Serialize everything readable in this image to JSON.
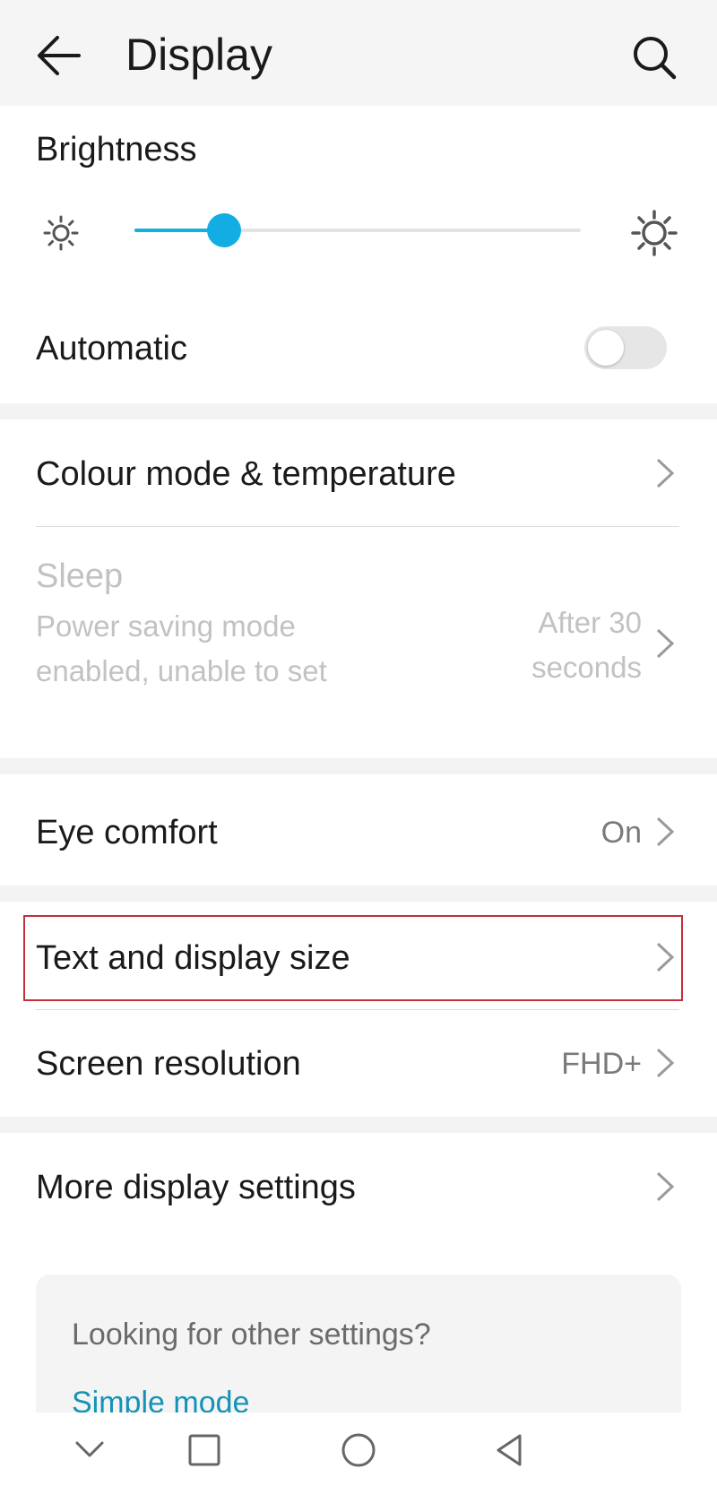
{
  "header": {
    "title": "Display",
    "back_icon": "arrow-left-icon",
    "search_icon": "search-icon"
  },
  "brightness": {
    "label": "Brightness",
    "level_fraction": 0.2,
    "accent_color": "#17aee0",
    "low_icon": "sun-small-icon",
    "high_icon": "sun-large-icon"
  },
  "automatic": {
    "label": "Automatic",
    "enabled": false
  },
  "rows": {
    "colour_mode": {
      "title": "Colour mode & temperature"
    },
    "sleep": {
      "title": "Sleep",
      "subtitle": "Power saving mode enabled, unable to set",
      "value": "After 30 seconds",
      "disabled": true
    },
    "eye_comfort": {
      "title": "Eye comfort",
      "value": "On"
    },
    "text_display_size": {
      "title": "Text and display size",
      "highlighted": true,
      "highlight_color": "#c0313d"
    },
    "screen_resolution": {
      "title": "Screen resolution",
      "value": "FHD+"
    },
    "more_display": {
      "title": "More display settings"
    }
  },
  "suggestion_card": {
    "question": "Looking for other settings?",
    "link": "Simple mode",
    "link_color": "#1493b7"
  },
  "nav": {
    "icons": [
      "chevron-down-icon",
      "square-recents-icon",
      "circle-home-icon",
      "triangle-back-icon"
    ]
  }
}
